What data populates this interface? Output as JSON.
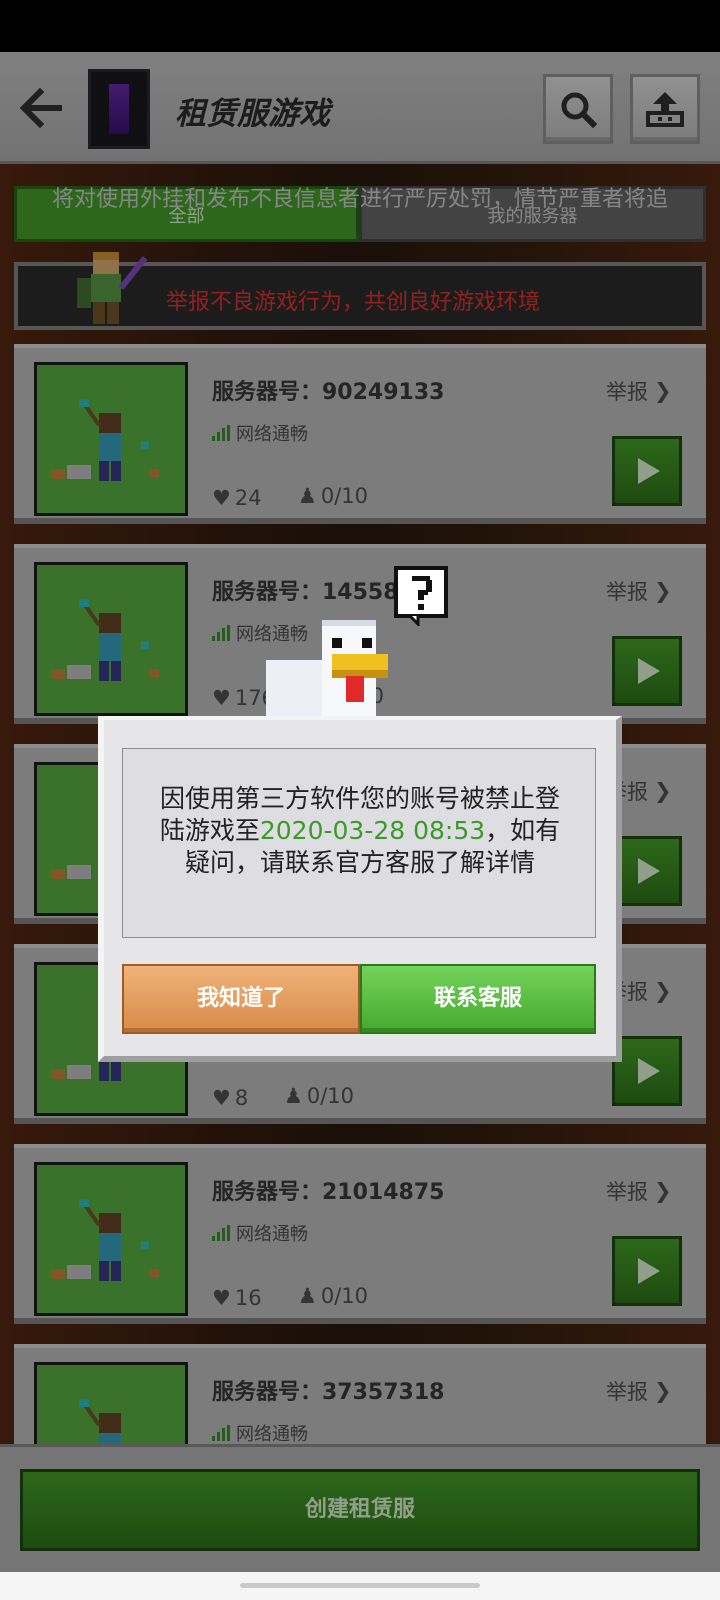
{
  "header": {
    "title": "租赁服游戏"
  },
  "notice": {
    "text": "将对使用外挂和发布不良信息者进行严厉处罚，情节严重者将追"
  },
  "tabs": [
    {
      "label": "全部"
    },
    {
      "label": "我的服务器"
    }
  ],
  "report_banner": {
    "text": "举报不良游戏行为，共创良好游戏环境"
  },
  "servers": [
    {
      "id_label": "服务器号：90249133",
      "network": "网络通畅",
      "likes": "24",
      "players": "0/10",
      "report": "举报"
    },
    {
      "id_label": "服务器号：14558",
      "network": "网络通畅",
      "likes": "176",
      "players": "0/10",
      "report": "举报"
    },
    {
      "id_label": "",
      "network": "",
      "likes": "",
      "players": "",
      "report": "举报"
    },
    {
      "id_label": "",
      "network": "",
      "likes": "8",
      "players": "0/10",
      "report": "举报"
    },
    {
      "id_label": "服务器号：21014875",
      "network": "网络通畅",
      "likes": "16",
      "players": "0/10",
      "report": "举报"
    },
    {
      "id_label": "服务器号：37357318",
      "network": "网络通畅",
      "likes": "",
      "players": "",
      "report": "举报"
    }
  ],
  "bottom": {
    "create_label": "创建租赁服"
  },
  "dialog": {
    "message_before": "因使用第三方软件您的账号被禁止登陆游戏至",
    "message_date": "2020-03-28 08:53",
    "message_after": "，如有疑问，请联系官方客服了解详情",
    "ok_label": "我知道了",
    "contact_label": "联系客服"
  },
  "colors": {
    "accent_green": "#4aa72c",
    "warning_red": "#e33333",
    "dialog_date_green": "#3c9a2a"
  }
}
